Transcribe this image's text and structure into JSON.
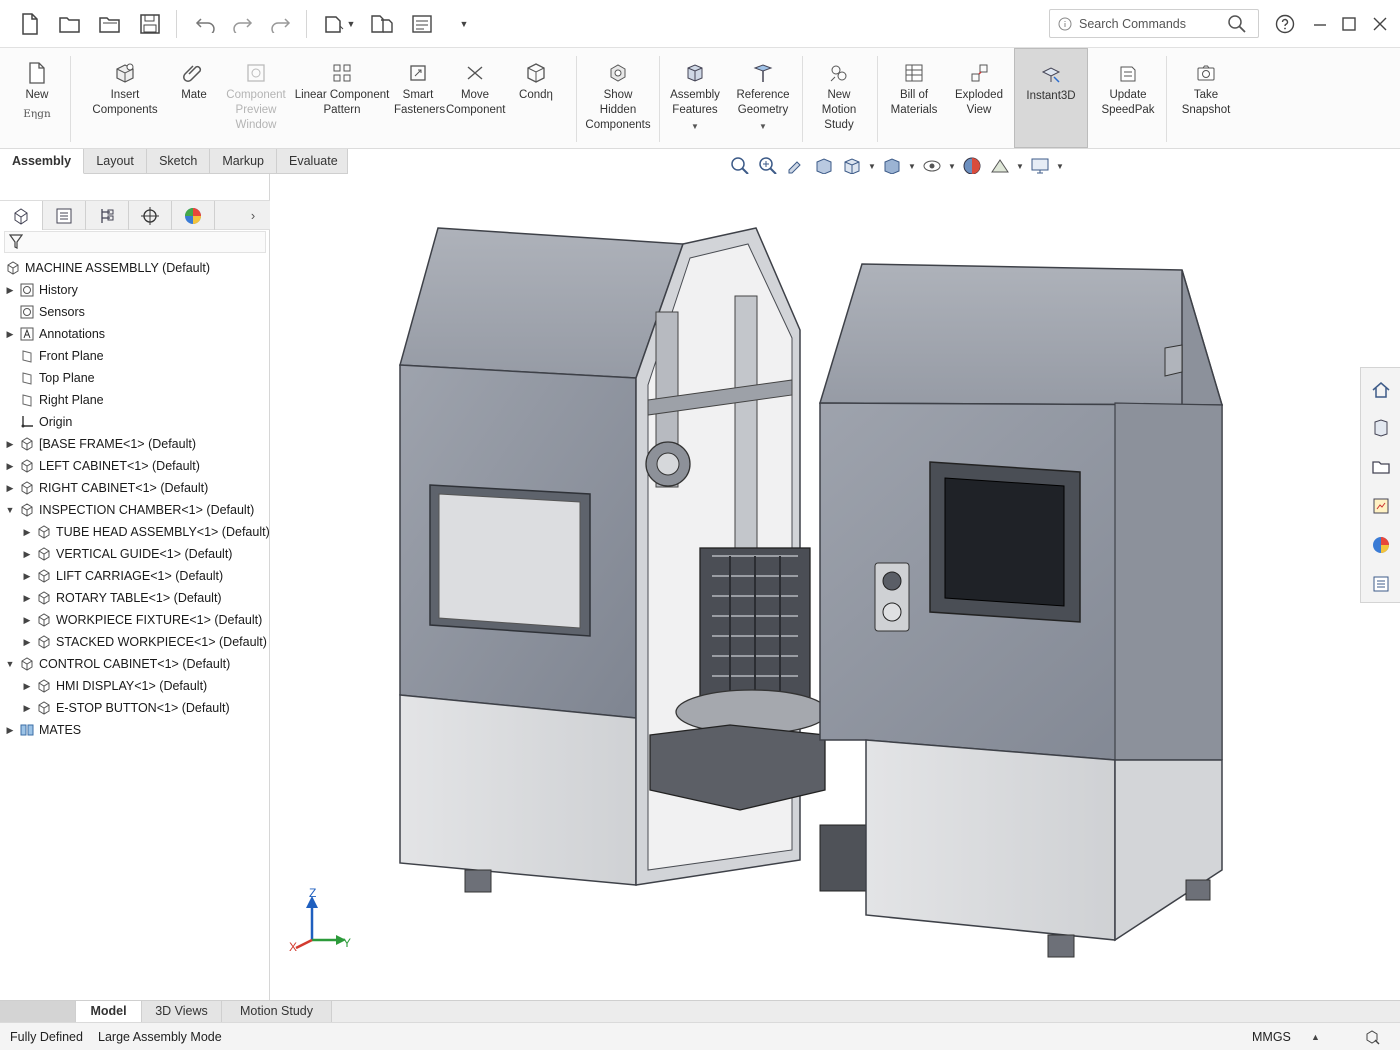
{
  "titlebar": {
    "search_placeholder": "Search Commands",
    "icons": [
      "new-file-icon",
      "open-folder-icon",
      "open-folder-icon",
      "save-icon",
      "undo-icon",
      "redo-icon",
      "redo-icon",
      "options-icon",
      "file-properties-icon",
      "rebuild-icon",
      "customize-caret-icon",
      "search-icon",
      "help-icon",
      "minimize-icon",
      "maximize-icon",
      "close-icon"
    ]
  },
  "ribbon": {
    "new": "New",
    "new_sub": "Eηgn",
    "insert_components": "Insert Components",
    "mate": "Mate",
    "component_preview": "Component Preview Window",
    "linear_pattern": "Linear Component Pattern",
    "smart_fasteners": "Smart Fasteners",
    "move_component": "Move Component",
    "condn": "Condη",
    "show_hidden": "Show Hidden Components",
    "assembly_features": "Assembly Features",
    "reference_geometry": "Reference Geometry",
    "new_motion_study": "New Motion Study",
    "bill_of_materials": "Bill of Materials",
    "exploded_view": "Exploded View",
    "instant3d": "Instant3D",
    "update_speedpak": "Update SpeedPak",
    "take_snapshot": "Take Snapshot"
  },
  "command_tabs": [
    "Assembly",
    "Layout",
    "Sketch",
    "Markup",
    "Evaluate"
  ],
  "tree": {
    "root": "MACHINE ASSEMBLLY (Default)",
    "items": [
      {
        "label": "History"
      },
      {
        "label": "Sensors"
      },
      {
        "label": "Annotations"
      },
      {
        "label": "Front Plane"
      },
      {
        "label": "Top Plane"
      },
      {
        "label": "Right Plane"
      },
      {
        "label": "Origin"
      },
      {
        "label": "[BASE FRAME<1> (Default)"
      },
      {
        "label": "LEFT CABINET<1> (Default)"
      },
      {
        "label": "RIGHT CABINET<1> (Default)"
      },
      {
        "label": "INSPECTION CHAMBER<1> (Default)"
      },
      {
        "label": "TUBE HEAD ASSEMBLY<1> (Default)"
      },
      {
        "label": "VERTICAL GUIDE<1> (Default)"
      },
      {
        "label": "LIFT CARRIAGE<1> (Default)"
      },
      {
        "label": "ROTARY TABLE<1> (Default)"
      },
      {
        "label": "WORKPIECE FIXTURE<1> (Default)"
      },
      {
        "label": "STACKED WORKPIECE<1> (Default)"
      },
      {
        "label": "CONTROL CABINET<1> (Default)"
      },
      {
        "label": "HMI DISPLAY<1> (Default)"
      },
      {
        "label": "E-STOP BUTTON<1> (Default)"
      },
      {
        "label": "MATES"
      }
    ]
  },
  "triad": {
    "z": "Z",
    "y": "Y",
    "x": "X"
  },
  "bottom_tabs": [
    "Model",
    "3D Views",
    "Motion Study 1"
  ],
  "status": {
    "left1": "Fully Defined",
    "left2": "Large Assembly Mode",
    "units": "MMGS"
  },
  "colors": {
    "accent_blue": "#1f5fbf",
    "cabinet_gray": "#8a8f99",
    "panel_light": "#d9dadc"
  }
}
